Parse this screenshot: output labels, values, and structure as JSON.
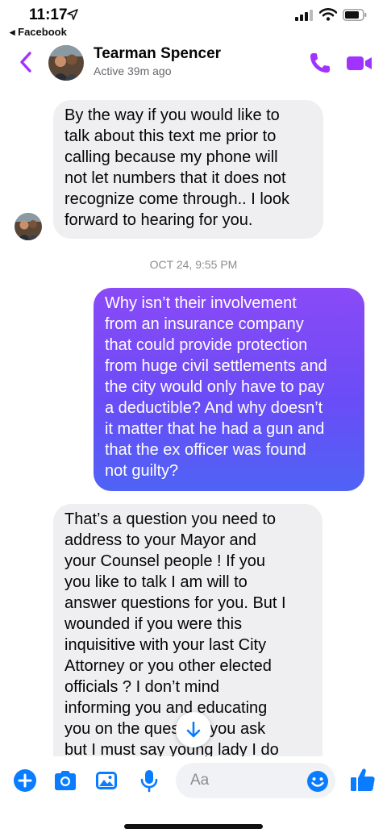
{
  "status_bar": {
    "time": "11:17",
    "back_app": "◂ Facebook"
  },
  "header": {
    "contact_name": "Tearman Spencer",
    "status": "Active 39m ago"
  },
  "messages": [
    {
      "direction": "incoming",
      "text": "By the way if you would like to\ntalk about this text me prior to\ncalling because my phone will\nnot let numbers that it does not\nrecognize come through.. I look\nforward to hearing for you."
    },
    {
      "direction": "outgoing",
      "text": "Why isn’t their involvement\nfrom an insurance company\nthat could provide protection\nfrom huge civil settlements and\nthe city would only have to pay\na deductible? And why doesn’t\nit matter that he had a gun and\nthat the ex officer was found\nnot guilty?"
    },
    {
      "direction": "incoming",
      "text": "That’s a question you need to\naddress to your Mayor and\nyour Counsel people !  If you\nyou like to talk I am will to\nanswer questions for you. But I\nwounded if you were this\ninquisitive with your last City\nAttorney or you other elected\nofficials ? I don’t mind\ninforming you and educating\nyou on the question you ask\nbut I must say young lady I do"
    }
  ],
  "timestamp": "OCT 24, 9:55 PM",
  "composer": {
    "placeholder": "Aa"
  },
  "colors": {
    "accent": "#a033ff",
    "incoming_bubble": "#efeff2",
    "outgoing_gradient_top": "#8a4af7",
    "outgoing_gradient_bottom": "#4f63f5",
    "action_blue": "#0a7cff"
  },
  "icons": {
    "back": "chevron-left-icon",
    "call": "phone-icon",
    "video": "video-camera-icon",
    "plus": "plus-icon",
    "camera": "camera-icon",
    "image": "image-icon",
    "mic": "microphone-icon",
    "emoji": "emoji-icon",
    "like": "thumbs-up-icon",
    "scroll": "arrow-down-icon"
  }
}
